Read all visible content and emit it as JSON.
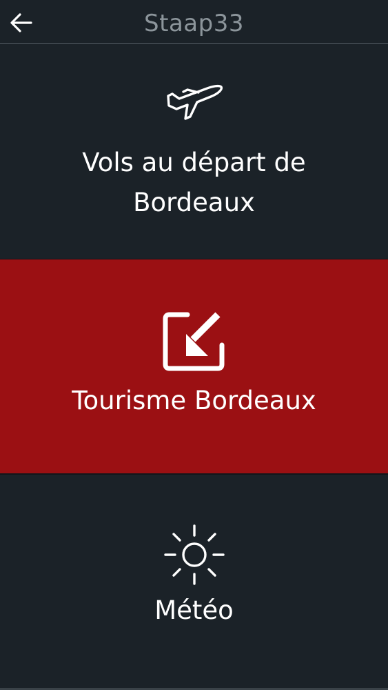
{
  "header": {
    "title": "Staap33",
    "back_icon": "arrow-left-icon"
  },
  "menu": {
    "items": [
      {
        "line1": "Vols au départ de",
        "line2": "Bordeaux",
        "icon": "airplane-icon",
        "background": "#1b2228"
      },
      {
        "label": "Tourisme Bordeaux",
        "icon": "external-link-box-icon",
        "background": "#9b1013"
      },
      {
        "label": "Météo",
        "icon": "sun-icon",
        "background": "#1b2228"
      }
    ]
  },
  "colors": {
    "background": "#1b2228",
    "accent": "#9b1013",
    "title": "#8c959b",
    "text": "#ffffff"
  }
}
